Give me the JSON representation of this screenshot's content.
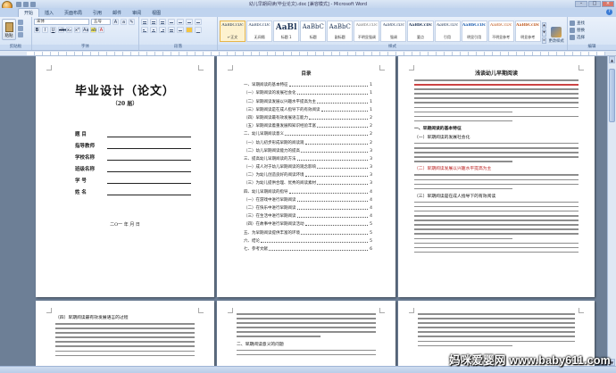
{
  "window": {
    "title": "幼儿早期阅读(毕业论文).doc [兼容模式] - Microsoft Word"
  },
  "ribbon": {
    "tabs": [
      "开始",
      "插入",
      "页面布局",
      "引用",
      "邮件",
      "审阅",
      "视图"
    ],
    "groups": {
      "clipboard": {
        "label": "剪贴板",
        "paste": "粘贴"
      },
      "font": {
        "label": "字体",
        "font_name": "宋体",
        "font_size": "五号"
      },
      "paragraph": {
        "label": "段落"
      },
      "styles": {
        "label": "样式",
        "items": [
          {
            "sample": "AaBbCcDc",
            "name": "↵正文"
          },
          {
            "sample": "AaBbCcDc",
            "name": "无间隔"
          },
          {
            "sample": "AaBl",
            "name": "标题 1"
          },
          {
            "sample": "AaBbC",
            "name": "标题"
          },
          {
            "sample": "AaBbC",
            "name": "副标题"
          },
          {
            "sample": "AaBbCcDc",
            "name": "不明显强调"
          },
          {
            "sample": "AaBbCcDc",
            "name": "强调"
          },
          {
            "sample": "AaBbCcDc",
            "name": "要点"
          },
          {
            "sample": "AaBbCcDc",
            "name": "引用"
          },
          {
            "sample": "AaBbCcDc",
            "name": "明显引用"
          },
          {
            "sample": "AaBbCcDc",
            "name": "不明显参考"
          },
          {
            "sample": "AaBbCcDc",
            "name": "明显参考"
          },
          {
            "sample": "AaBbCcDc",
            "name": "书籍标题"
          }
        ],
        "change_styles": "更改样式"
      },
      "editing": {
        "label": "编辑",
        "find": "查找",
        "replace": "替换",
        "select": "选择"
      }
    }
  },
  "pages": {
    "cover": {
      "title": "毕业设计（论文）",
      "year": "（20 届）",
      "fields": [
        "题    目",
        "指导教师",
        "学校名称",
        "班级名称",
        "学    号",
        "姓    名"
      ],
      "date": "二O一  年    月    日"
    },
    "toc": {
      "title": "目录",
      "rows": [
        {
          "t": "一、早期阅读的基本特征",
          "n": "1"
        },
        {
          "t": "（一）早期阅读的发展社会化",
          "n": "1"
        },
        {
          "t": "（二）早期阅读发展以兴趣水平提高为主",
          "n": "1"
        },
        {
          "t": "（三）早期阅读是在成人指导下的有效阅读",
          "n": "1"
        },
        {
          "t": "（四）早期阅读最有效发展语言能力",
          "n": "2"
        },
        {
          "t": "（五）早期阅读着重发展和知识经验丰富",
          "n": "2"
        },
        {
          "t": "二、幼儿早期阅读意义",
          "n": "2"
        },
        {
          "t": "（一）幼儿初步形成早期的阅读观",
          "n": "2"
        },
        {
          "t": "（二）幼儿早期阅读能力的提高",
          "n": "3"
        },
        {
          "t": "三、提高幼儿早期阅读的方法",
          "n": "3"
        },
        {
          "t": "（一）成人对于幼儿早期阅读的观念影响",
          "n": "3"
        },
        {
          "t": "（二）为幼儿创造良好的阅读环境",
          "n": "3"
        },
        {
          "t": "（三）为幼儿提供合理、优秀的阅读素材",
          "n": "3"
        },
        {
          "t": "四、幼儿早期阅读的指导",
          "n": "4"
        },
        {
          "t": "（一）在游戏中进行早期阅读",
          "n": "4"
        },
        {
          "t": "（二）在快乐中进行早期阅读",
          "n": "4"
        },
        {
          "t": "（三）在生活中进行早期阅读",
          "n": "4"
        },
        {
          "t": "（四）在故事中进行早期阅读活动",
          "n": "5"
        },
        {
          "t": "五、为早期阅读提供丰富的环境",
          "n": "5"
        },
        {
          "t": "六、结论",
          "n": "5"
        },
        {
          "t": "七、参考文献",
          "n": "6"
        }
      ]
    },
    "article": {
      "title": "浅谈幼儿早期阅读",
      "heads": [
        "一、早期阅读的基本特征",
        "（一）早期阅读的发展社会化",
        "（二）早期阅读发展以兴趣水平提高为主",
        "（三）早期阅读是在成人指导下的有效阅读"
      ]
    },
    "page4": {
      "head": "（四）早期阅读最有效发展语言的过程"
    },
    "page5": {
      "head": "二、早期阅读意义的问题"
    }
  },
  "watermark": "妈咪爱婴网  www.baby611.com"
}
